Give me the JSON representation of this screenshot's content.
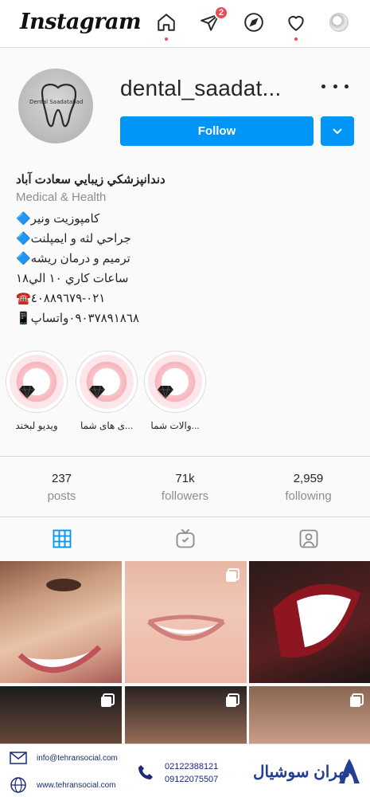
{
  "nav": {
    "logo": "Instagram",
    "badge_count": "2"
  },
  "profile": {
    "username": "dental_saadat...",
    "avatar_text": "Dental Saadatabad",
    "follow_label": "Follow"
  },
  "bio": {
    "name": "دندانپزشکي زيبايي سعادت آباد",
    "category": "Medical & Health",
    "lines": [
      "کامپوزیت ونیر🔷",
      "جراحي لثه و ايمپلنت🔷",
      "ترميم و درمان ريشه🔷",
      "ساعات کاري ١٠ الي١٨",
      "☎️٠٢١-٤٠٨٨٩٦٧٩",
      "٠٩٠٣٧٨٩١٨٦٨واتساپ📱"
    ]
  },
  "highlights": [
    {
      "label": "ويديو لبخند"
    },
    {
      "label": "...ی های شما"
    },
    {
      "label": "...والات شما"
    }
  ],
  "stats": {
    "posts": {
      "value": "237",
      "label": "posts"
    },
    "followers": {
      "value": "71k",
      "label": "followers"
    },
    "following": {
      "value": "2,959",
      "label": "following"
    }
  },
  "footer": {
    "email": "info@tehransocial.com",
    "site": "www.tehransocial.com",
    "phone1": "02122388121",
    "phone2": "09122075507",
    "brand": "تهران سوشیال"
  },
  "colors": {
    "accent": "#0095f6",
    "notification": "#ed4956",
    "grid_tab": "#0095f6"
  },
  "icons": [
    "home-icon",
    "direct-icon",
    "explore-icon",
    "heart-icon",
    "grid-icon",
    "igtv-icon",
    "tagged-icon",
    "more-icon",
    "chevron-down-icon",
    "multi-post-icon"
  ]
}
